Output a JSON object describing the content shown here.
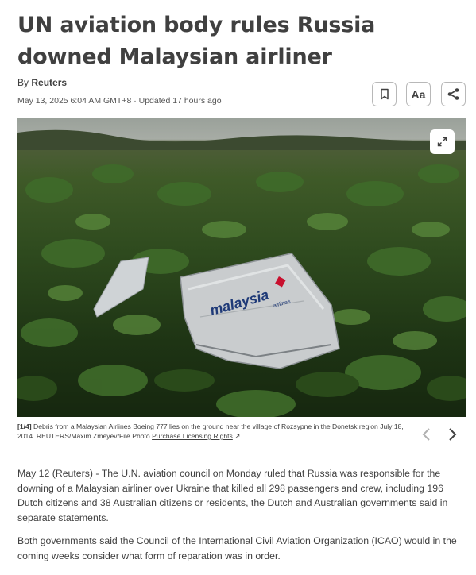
{
  "article": {
    "headline": "UN aviation body rules Russia downed Malaysian airliner",
    "byline_prefix": "By",
    "byline_author": "Reuters",
    "dateline": "May 13, 2025 6:04 AM GMT+8 · Updated 17 hours ago"
  },
  "toolbar": {
    "bookmark_icon": "bookmark-icon",
    "text_size_label": "Aa",
    "share_icon": "share-icon"
  },
  "photo": {
    "alt": "Debris from a Malaysian Airlines Boeing 777 in a field",
    "debris_text": "malaysia",
    "debris_subtext": "airlines",
    "expand_icon": "expand-icon"
  },
  "caption": {
    "counter": "[1/4]",
    "text": " Debris from a Malaysian Airlines Boeing 777 lies on the ground near the village of Rozsypne in the Donetsk region July 18, 2014. REUTERS/Maxim Zmeyev/File Photo ",
    "link": "Purchase Licensing Rights",
    "external_icon": "↗"
  },
  "gallery_nav": {
    "prev_icon": "chevron-left-icon",
    "next_icon": "chevron-right-icon"
  },
  "body": {
    "p1": "May 12 (Reuters) - The U.N. aviation council on Monday ruled that Russia was responsible for the downing of a Malaysian airliner over Ukraine that killed all 298 passengers and crew, including 196 Dutch citizens and 38 Australian citizens or residents, the Dutch and Australian governments said in separate statements.",
    "p2": "Both governments said the Council of the International Civil Aviation Organization (ICAO) would in the coming weeks consider what form of reparation was in order."
  }
}
